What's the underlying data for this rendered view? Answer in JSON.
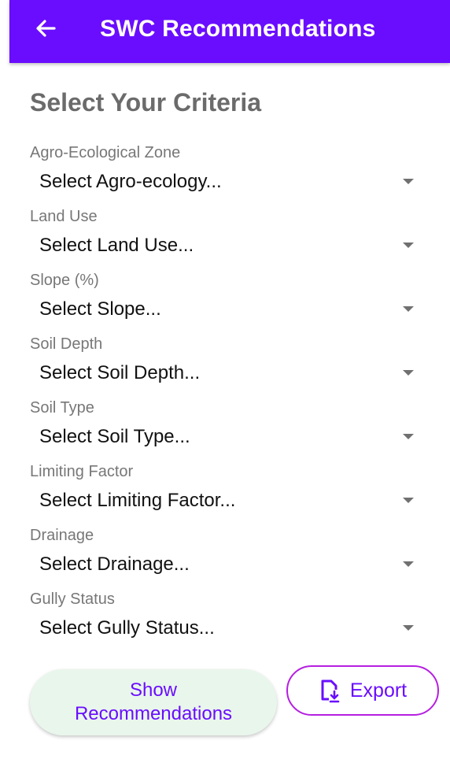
{
  "header": {
    "title": "SWC Recommendations",
    "background_color": "#6a0dff",
    "back_icon": "arrow-left-icon"
  },
  "main": {
    "section_title": "Select Your Criteria",
    "fields": [
      {
        "label": "Agro-Ecological Zone",
        "value": "Select Agro-ecology..."
      },
      {
        "label": "Land Use",
        "value": "Select Land Use..."
      },
      {
        "label": "Slope (%)",
        "value": "Select Slope..."
      },
      {
        "label": "Soil Depth",
        "value": "Select Soil Depth..."
      },
      {
        "label": "Soil Type",
        "value": "Select Soil Type..."
      },
      {
        "label": "Limiting Factor",
        "value": "Select Limiting Factor..."
      },
      {
        "label": "Drainage",
        "value": "Select Drainage..."
      },
      {
        "label": "Gully Status",
        "value": "Select Gully Status..."
      }
    ]
  },
  "actions": {
    "show_recommendations_line1": "Show",
    "show_recommendations_line2": "Recommendations",
    "show_button_color": "#e9f6ec",
    "export_label": "Export",
    "export_icon": "file-download-icon",
    "export_border_color": "#b51fe0"
  }
}
